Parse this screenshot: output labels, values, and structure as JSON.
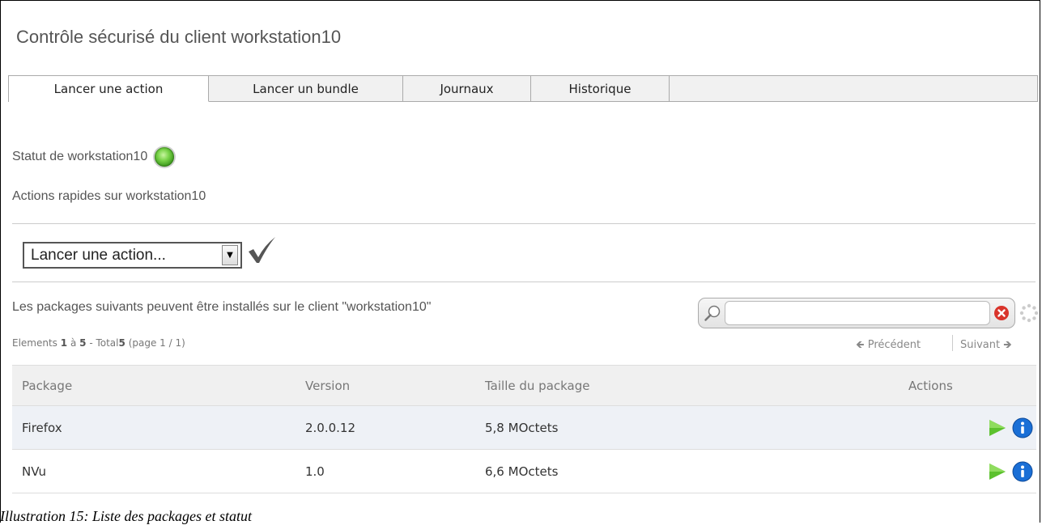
{
  "page": {
    "title": "Contrôle sécurisé du client workstation10",
    "caption": "Illustration 15: Liste des packages et statut"
  },
  "tabs": [
    {
      "label": "Lancer une action",
      "active": true
    },
    {
      "label": "Lancer un bundle",
      "active": false
    },
    {
      "label": "Journaux",
      "active": false
    },
    {
      "label": "Historique",
      "active": false
    }
  ],
  "status": {
    "label": "Statut de workstation10",
    "indicator_color": "#5cc12e",
    "icon": "status-led-icon"
  },
  "quick_actions": {
    "label": "Actions rapides sur workstation10",
    "select_value": "Lancer une action...",
    "confirm_icon": "checkmark-icon"
  },
  "packages": {
    "intro": "Les packages suivants peuvent être installés sur le client \"workstation10\"",
    "elements_prefix": "Elements",
    "range_start": "1",
    "range_word": "à",
    "range_end": "5",
    "total_word": "- Total",
    "total": "5",
    "page_info": "(page 1 / 1)",
    "search_value": "",
    "prev_label": "Précédent",
    "next_label": "Suivant",
    "columns": [
      "Package",
      "Version",
      "Taille du package",
      "Actions"
    ],
    "rows": [
      {
        "package": "Firefox",
        "version": "2.0.0.12",
        "size": "5,8 MOctets"
      },
      {
        "package": "NVu",
        "version": "1.0",
        "size": "6,6 MOctets"
      }
    ]
  },
  "colors": {
    "play": "#5cc12e",
    "info": "#1a6fd6",
    "clear": "#d9342b"
  }
}
